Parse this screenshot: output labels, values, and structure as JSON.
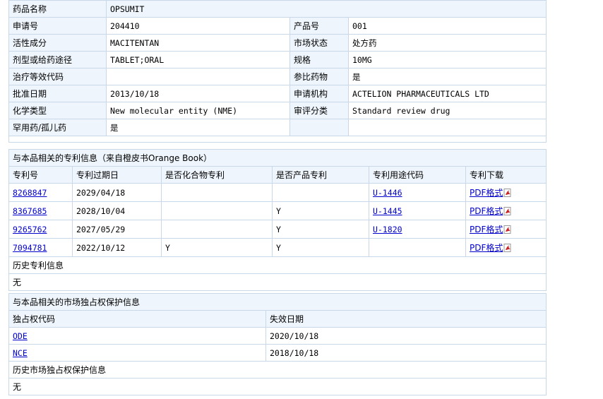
{
  "drug": {
    "rows": [
      [
        {
          "label": "药品名称",
          "value": "OPSUMIT"
        }
      ],
      [
        {
          "label": "申请号",
          "value": "204410"
        },
        {
          "label": "产品号",
          "value": "001"
        }
      ],
      [
        {
          "label": "活性成分",
          "value": "MACITENTAN"
        },
        {
          "label": "市场状态",
          "value": "处方药"
        }
      ],
      [
        {
          "label": "剂型或给药途径",
          "value": "TABLET;ORAL"
        },
        {
          "label": "规格",
          "value": "10MG"
        }
      ],
      [
        {
          "label": "治疗等效代码",
          "value": ""
        },
        {
          "label": "参比药物",
          "value": "是"
        }
      ],
      [
        {
          "label": "批准日期",
          "value": "2013/10/18"
        },
        {
          "label": "申请机构",
          "value": "ACTELION PHARMACEUTICALS LTD"
        }
      ],
      [
        {
          "label": "化学类型",
          "value": "New molecular entity (NME)"
        },
        {
          "label": "审评分类",
          "value": "Standard review drug"
        }
      ],
      [
        {
          "label": "罕用药/孤儿药",
          "value": "是"
        },
        {
          "label": "",
          "value": ""
        }
      ]
    ]
  },
  "patents": {
    "title": "与本品相关的专利信息（来自橙皮书Orange Book）",
    "headers": [
      "专利号",
      "专利过期日",
      "是否化合物专利",
      "是否产品专利",
      "专利用途代码",
      "专利下载"
    ],
    "rows": [
      {
        "no": "8268847",
        "expiry": "2029/04/18",
        "compound": "",
        "product": "",
        "use": "U-1446",
        "download": "PDF格式"
      },
      {
        "no": "8367685",
        "expiry": "2028/10/04",
        "compound": "",
        "product": "Y",
        "use": "U-1445",
        "download": "PDF格式"
      },
      {
        "no": "9265762",
        "expiry": "2027/05/29",
        "compound": "",
        "product": "Y",
        "use": "U-1820",
        "download": "PDF格式"
      },
      {
        "no": "7094781",
        "expiry": "2022/10/12",
        "compound": "Y",
        "product": "Y",
        "use": "",
        "download": "PDF格式"
      }
    ],
    "history_label": "历史专利信息",
    "history_value": "无"
  },
  "exclusivity": {
    "title": "与本品相关的市场独占权保护信息",
    "headers": [
      "独占权代码",
      "失效日期"
    ],
    "rows": [
      {
        "code": "ODE",
        "date": "2020/10/18"
      },
      {
        "code": "NCE",
        "date": "2018/10/18"
      }
    ],
    "history_label": "历史市场独占权保护信息",
    "history_value": "无"
  },
  "colors": {
    "label_bg": "#eef5fc",
    "border": "#c8d8e8",
    "link": "#0000cc",
    "pdf_red": "#cc2222"
  },
  "icons": {
    "pdf": "pdf-file-icon"
  }
}
